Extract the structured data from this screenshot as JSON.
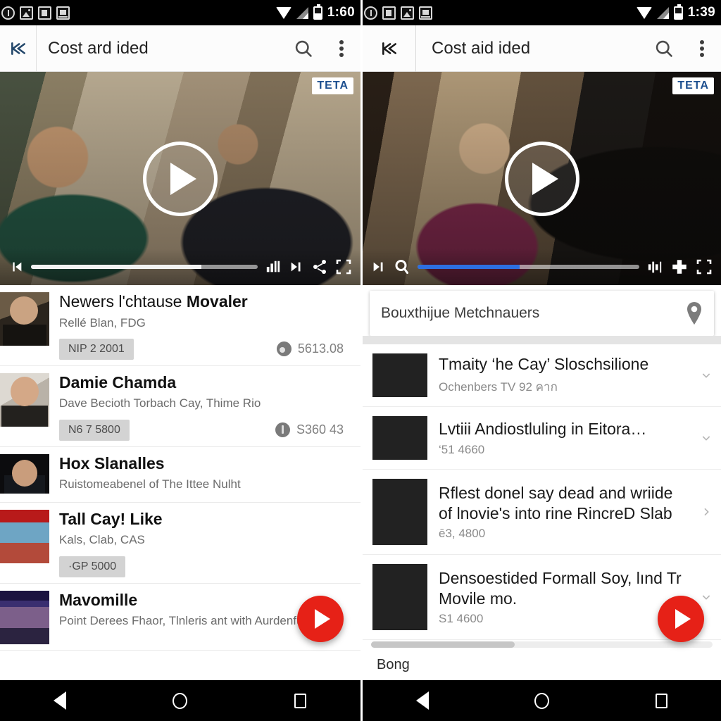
{
  "left": {
    "status_bar": {
      "clock": "1:60",
      "icons": [
        "circle-icon",
        "photo-icon",
        "cup-icon",
        "monitor-icon",
        "wifi-icon",
        "signal-icon",
        "battery-icon"
      ]
    },
    "toolbar": {
      "back_icon": "collapse-left-icon",
      "title": "Cost ard ided",
      "search_icon": "search-icon",
      "overflow_icon": "more-vertical-icon"
    },
    "video": {
      "badge": "TETA",
      "play_icon": "play-circle-icon",
      "controls": {
        "prev_icon": "skip-previous-icon",
        "progress_percent": 75,
        "equalizer_icon": "equalizer-icon",
        "next_icon": "skip-next-icon",
        "share_icon": "share-icon",
        "fullscreen_icon": "fullscreen-icon"
      }
    },
    "list": [
      {
        "title_plain": "Newers l'chtause ",
        "title_bold": "Movaler",
        "subtitle": "Rellé Blan, FDG",
        "chip": "NIP 2 2001",
        "meta_icon": "cloud-icon",
        "meta_value": "5613.08",
        "thumb": "actor-photo"
      },
      {
        "title_plain": "",
        "title_bold": "Damie Chamda",
        "subtitle": "Dave Becioth Torbach Cay, Thime Rio",
        "chip": "N6 7 5800",
        "meta_icon": "info-icon",
        "meta_value": "S360 43",
        "thumb": "actor-photo"
      },
      {
        "title_plain": "",
        "title_bold": "Hox Slanalles",
        "subtitle": "Ruistomeabenel of The Ittee Nulht",
        "chip": "",
        "meta_icon": "",
        "meta_value": "",
        "thumb": "actor-photo"
      },
      {
        "title_plain": "",
        "title_bold": "Tall Cay! Like",
        "subtitle": "Kals, Clab, CAS",
        "chip": "·GP 5000",
        "meta_icon": "",
        "meta_value": "",
        "thumb": "movie-poster"
      },
      {
        "title_plain": "",
        "title_bold": "Mavomille",
        "subtitle": "Point Derees Fhaor, Tlnleris ant with Aurdenfu",
        "chip": "",
        "meta_icon": "",
        "meta_value": "",
        "thumb": "movie-poster"
      }
    ],
    "fab_icon": "play-fab-icon",
    "navbar": [
      "back-icon",
      "home-icon",
      "recents-icon"
    ]
  },
  "right": {
    "status_bar": {
      "clock": "1:39",
      "icons": [
        "circle-icon",
        "cup-icon",
        "photo-icon",
        "monitor-icon",
        "wifi-icon",
        "signal-icon",
        "battery-icon"
      ]
    },
    "toolbar": {
      "back_icon": "collapse-left-icon",
      "title": "Cost aid ided",
      "search_icon": "search-icon",
      "overflow_icon": "more-vertical-icon"
    },
    "video": {
      "badge": "TETA",
      "play_icon": "play-circle-icon",
      "controls": {
        "next_icon": "skip-next-icon",
        "search_icon": "search-icon",
        "progress_percent": 46,
        "equalizer_icon": "equalizer-icon",
        "plus_icon": "plus-icon",
        "fullscreen_icon": "fullscreen-icon"
      }
    },
    "location_card": {
      "text": "Bouxthijue Metchnauers",
      "pin_icon": "map-pin-icon"
    },
    "list": [
      {
        "title": "Tmaity ‘he Cay’ Sloschsilione",
        "subtitle": "Ochenbers TV 92 คาก",
        "chevron": "chevron-down-icon",
        "thumb": "webcam-photo"
      },
      {
        "title": "Lvtiii Andiostluling in Eitora…",
        "subtitle": "‘51 4660",
        "chevron": "chevron-down-icon",
        "thumb": "actor-photo"
      },
      {
        "title": "Rflest donel say dead and wriide of lnovie's into rine RincreD Slab",
        "subtitle": "ē3, 4800",
        "chevron": "chevron-right-icon",
        "thumb": "movie-poster"
      },
      {
        "title": "Densoestided Formall Soy, lınd Tr Movile mo.",
        "subtitle": "S1 4600",
        "chevron": "chevron-down-icon",
        "thumb": "movie-poster"
      }
    ],
    "scroll_label": "Bong",
    "fab_icon": "play-fab-icon",
    "navbar": [
      "back-icon",
      "home-icon",
      "recents-icon"
    ]
  },
  "colors": {
    "fab_red": "#e62117",
    "progress_blue": "#2d6fe0",
    "badge_blue": "#1d4f8f",
    "toolbar_bg": "#fcfcfc"
  }
}
